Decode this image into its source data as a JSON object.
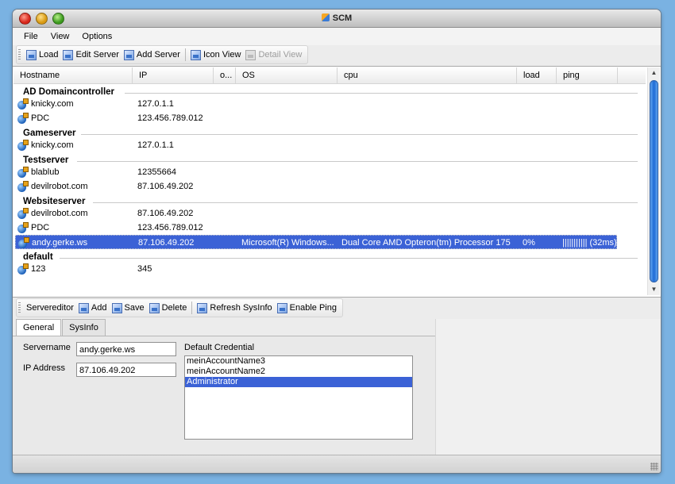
{
  "window": {
    "title": "SCM"
  },
  "menu": [
    "File",
    "View",
    "Options"
  ],
  "toolbar": {
    "load": "Load",
    "edit_server": "Edit Server",
    "add_server": "Add Server",
    "icon_view": "Icon View",
    "detail_view": "Detail View"
  },
  "columns": [
    "Hostname",
    "IP",
    "o...",
    "OS",
    "cpu",
    "load",
    "ping"
  ],
  "groups": {
    "ad": "AD Domaincontroller",
    "game": "Gameserver",
    "test": "Testserver",
    "web": "Websiteserver",
    "default": "default"
  },
  "rows": [
    {
      "host": "knicky.com",
      "ip": "127.0.1.1"
    },
    {
      "host": "PDC",
      "ip": "123.456.789.012"
    },
    {
      "host": "knicky.com",
      "ip": "127.0.1.1"
    },
    {
      "host": "blablub",
      "ip": "12355664"
    },
    {
      "host": "devilrobot.com",
      "ip": "87.106.49.202"
    },
    {
      "host": "devilrobot.com",
      "ip": "87.106.49.202"
    },
    {
      "host": "PDC",
      "ip": "123.456.789.012"
    },
    {
      "host": "andy.gerke.ws",
      "ip": "87.106.49.202",
      "os": "Microsoft(R) Windows...",
      "cpu": "Dual Core AMD Opteron(tm) Processor 175",
      "load": "0%",
      "ping": "||||||||||| (32ms)"
    },
    {
      "host": "123",
      "ip": "345"
    }
  ],
  "editor_toolbar": {
    "title": "Servereditor",
    "add": "Add",
    "save": "Save",
    "delete": "Delete",
    "refresh": "Refresh SysInfo",
    "ping": "Enable Ping"
  },
  "tabs": {
    "general": "General",
    "sysinfo": "SysInfo"
  },
  "form": {
    "servername_label": "Servername",
    "servername_value": "andy.gerke.ws",
    "ip_label": "IP Address",
    "ip_value": "87.106.49.202",
    "credential_label": "Default Credential",
    "credentials": [
      "meinAccountName3",
      "meinAccountName2",
      "Administrator"
    ]
  },
  "colors": {
    "selection": "#3b62d6",
    "scrollbar": "#1e6bd6",
    "desktop": "#7ab2e2"
  }
}
